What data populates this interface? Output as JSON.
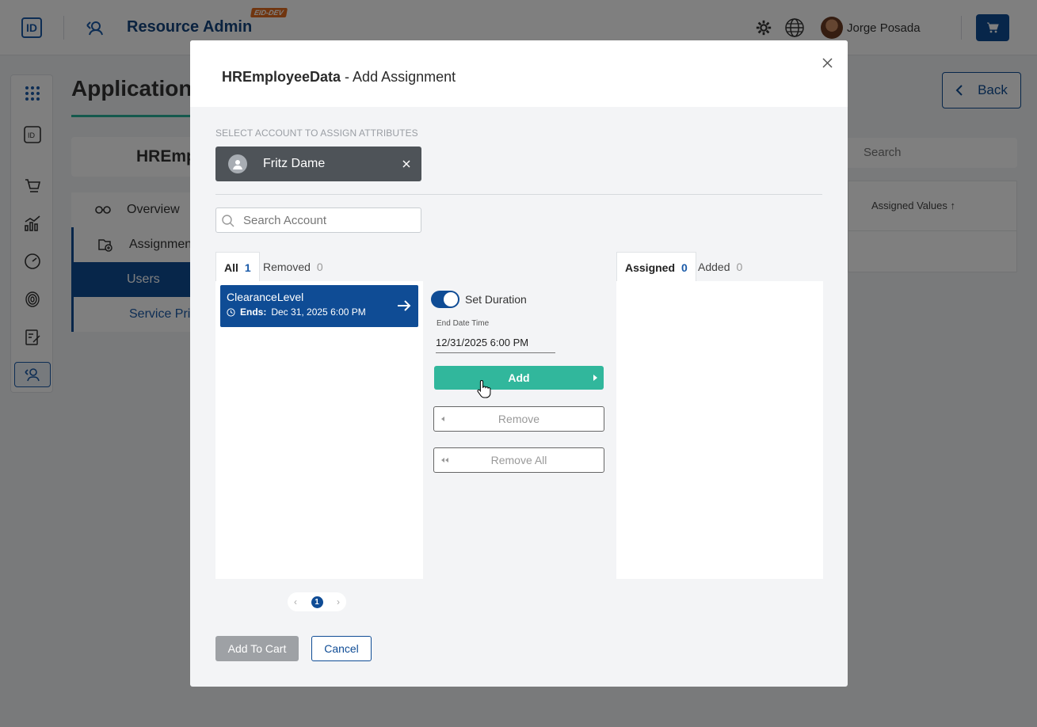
{
  "app": {
    "logo_text": "ID",
    "title": "Resource Admin",
    "env_badge": "EID-DEV",
    "user_name": "Jorge Posada",
    "icons": [
      "logo-icon",
      "resource-admin-icon",
      "gear-icon",
      "globe-icon",
      "avatar",
      "cart-icon"
    ]
  },
  "background": {
    "page_title": "Applications",
    "back_label": "Back",
    "entity_name": "HREmp",
    "nav": {
      "overview": "Overview",
      "assignments": "Assignmen",
      "users": "Users",
      "service_principals": "Service Pri"
    },
    "search_label": "Search",
    "table_header": "Assigned Values"
  },
  "modal": {
    "title_bold": "HREmployeeData",
    "title_rest": " - Add Assignment",
    "select_account_label": "SELECT ACCOUNT TO ASSIGN ATTRIBUTES",
    "selected_account": "Fritz Dame",
    "search_placeholder": "Search Account",
    "left_tabs": [
      {
        "label": "All",
        "count": "1"
      },
      {
        "label": "Removed",
        "count": "0"
      }
    ],
    "right_tabs": [
      {
        "label": "Assigned",
        "count": "0"
      },
      {
        "label": "Added",
        "count": "0"
      }
    ],
    "attribute": {
      "name": "ClearanceLevel",
      "ends_label": "Ends:",
      "ends_value": "Dec 31, 2025 6:00 PM"
    },
    "set_duration": {
      "label": "Set Duration",
      "enabled": true
    },
    "end_date_label": "End Date Time",
    "end_date_value": "12/31/2025 6:00 PM",
    "buttons": {
      "add": "Add",
      "remove": "Remove",
      "remove_all": "Remove All",
      "add_to_cart": "Add To Cart",
      "cancel": "Cancel"
    },
    "pager": {
      "current": "1"
    }
  },
  "colors": {
    "primary": "#0f4c95",
    "accent_green": "#31b79c",
    "chip_bg": "#4e5358",
    "disabled_btn": "#9ea1a5"
  }
}
